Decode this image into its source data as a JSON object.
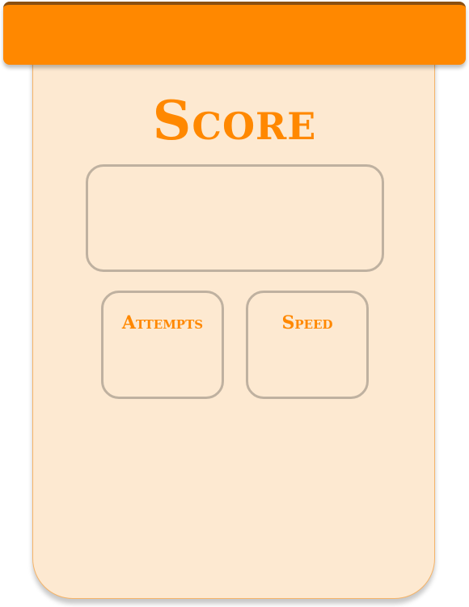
{
  "header": {
    "title": "",
    "accent_color": "#ff8800",
    "border_color": "#8a4f10"
  },
  "score_panel": {
    "title": "Score",
    "value": "",
    "background_color": "#fde9d1",
    "box_border_color": "#bfb1a0"
  },
  "stats": {
    "attempts": {
      "label": "Attempts",
      "value": ""
    },
    "speed": {
      "label": "Speed",
      "value": ""
    }
  }
}
